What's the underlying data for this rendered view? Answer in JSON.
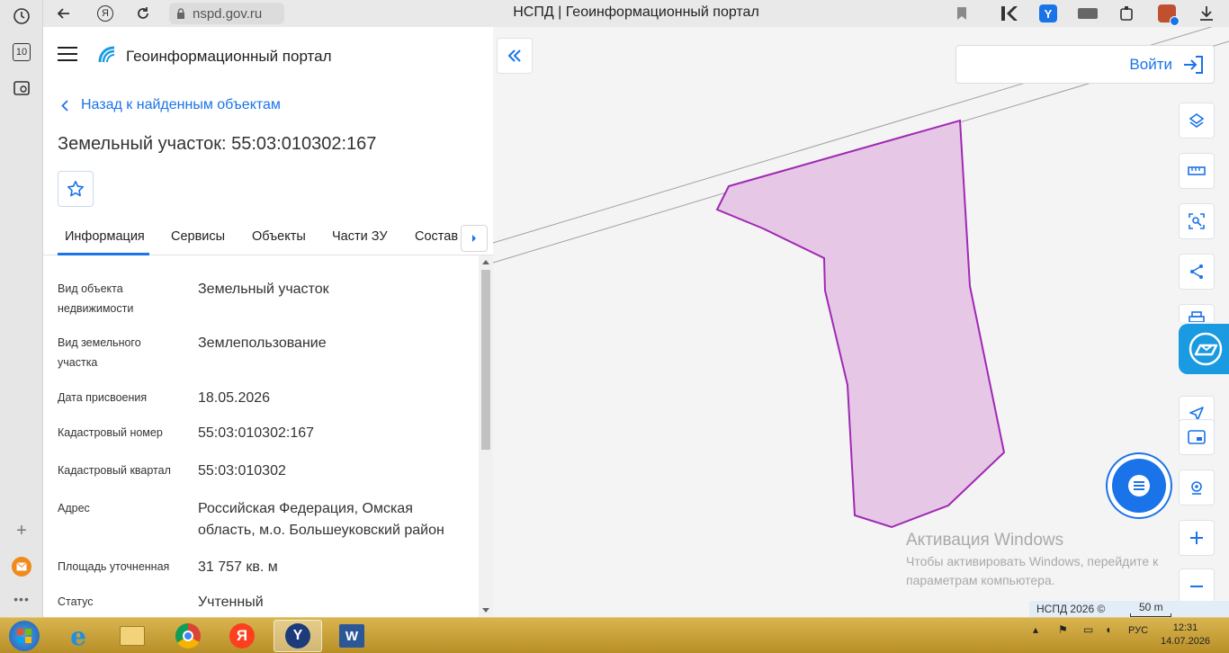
{
  "browser": {
    "url": "nspd.gov.ru",
    "window_title": "НСПД | Геоинформационный портал",
    "rail_badge": "10"
  },
  "panel": {
    "portal_name": "Геоинформационный портал",
    "back_link": "Назад к найденным объектам",
    "object_title": "Земельный участок: 55:03:010302:167",
    "tabs": [
      {
        "label": "Информация",
        "active": true
      },
      {
        "label": "Сервисы"
      },
      {
        "label": "Объекты"
      },
      {
        "label": "Части ЗУ"
      },
      {
        "label": "Состав"
      }
    ],
    "fields": [
      {
        "label": "Вид объекта недвижимости",
        "value": "Земельный участок"
      },
      {
        "label": "Вид земельного участка",
        "value": "Землепользование"
      },
      {
        "label": "Дата присвоения",
        "value": "18.05.2026"
      },
      {
        "label": "Кадастровый номер",
        "value": "55:03:010302:167"
      },
      {
        "label": "Кадастровый квартал",
        "value": "55:03:010302"
      },
      {
        "label": "Адрес",
        "value": "Российская Федерация, Омская область, м.о. Большеуковский район"
      },
      {
        "label": "Площадь уточненная",
        "value": "31 757 кв. м"
      },
      {
        "label": "Статус",
        "value": "Учтенный"
      }
    ]
  },
  "map": {
    "login_label": "Войти",
    "watermark_title": "Активация Windows",
    "watermark_line1": "Чтобы активировать Windows, перейдите к",
    "watermark_line2": "параметрам компьютера.",
    "copyright": "НСПД 2026 ©",
    "scale_label": "50 m",
    "parcel_fill": "#e6c8e6",
    "parcel_stroke": "#a028b4",
    "accent": "#1a73e8"
  },
  "taskbar": {
    "language": "РУС",
    "time": "12:31",
    "date": "14.07.2026",
    "yandex_glyph": "Я"
  }
}
